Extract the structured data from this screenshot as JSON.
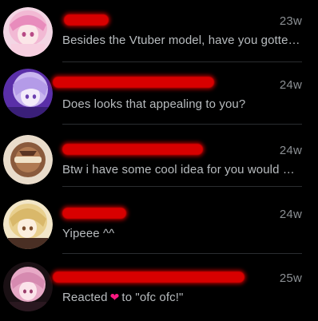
{
  "conversations": [
    {
      "time": "23w",
      "preview": "Besides the Vtuber model, have you gotte…",
      "avatar": "pink-hair-girl-avatar"
    },
    {
      "time": "24w",
      "preview": "Does looks that appealing to you?",
      "avatar": "purple-hair-girl-avatar"
    },
    {
      "time": "24w",
      "preview": "Btw i have some cool idea for you would …",
      "avatar": "brown-logo-avatar"
    },
    {
      "time": "24w",
      "preview": "Yipeee ^^",
      "avatar": "blonde-hair-girl-avatar"
    },
    {
      "time": "25w",
      "preview_prefix": "Reacted",
      "preview_suffix": "to \"ofc ofc!\"",
      "reaction_icon": "heart-icon",
      "avatar": "pink-dark-girl-avatar"
    }
  ],
  "colors": {
    "background": "#000000",
    "redaction": "#d80000",
    "heart": "#f91880",
    "muted_text": "#8b8f93"
  }
}
